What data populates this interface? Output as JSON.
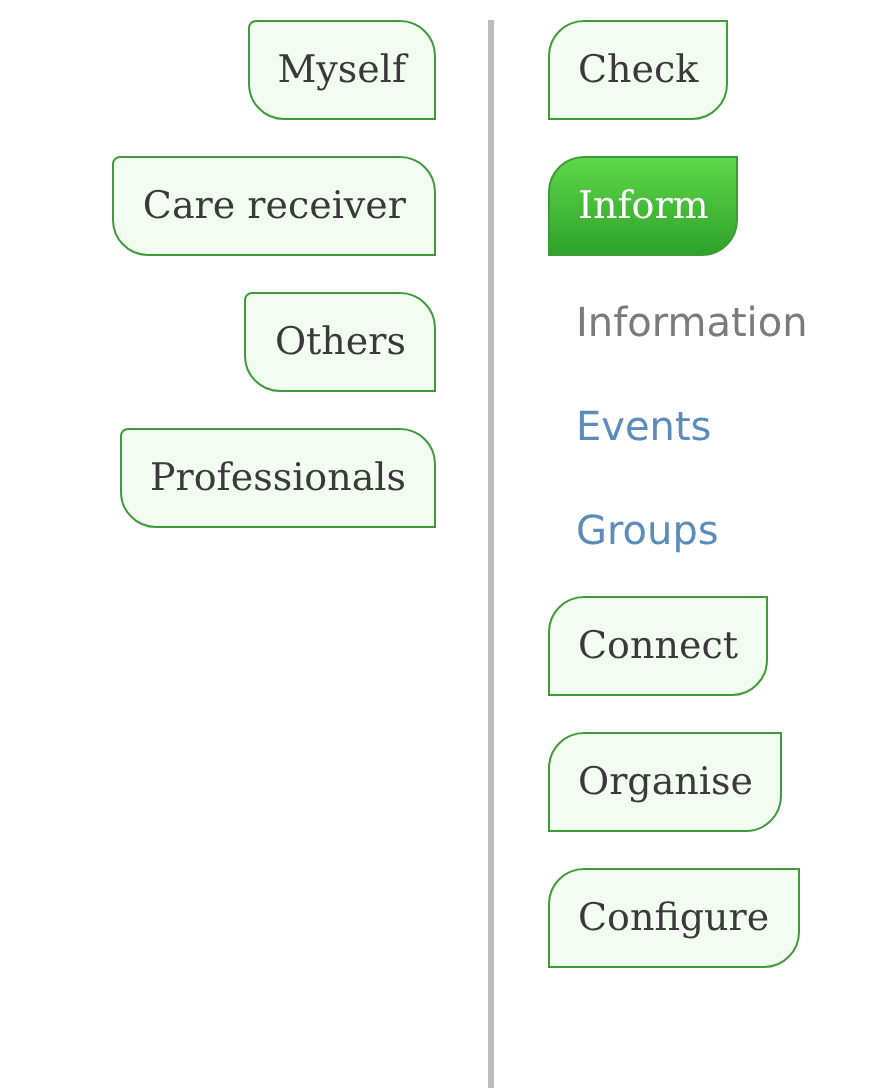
{
  "audiences": [
    {
      "label": "Myself",
      "selected": false
    },
    {
      "label": "Care receiver",
      "selected": false
    },
    {
      "label": "Others",
      "selected": false
    },
    {
      "label": "Professionals",
      "selected": false
    }
  ],
  "sections": [
    {
      "label": "Check",
      "selected": false
    },
    {
      "label": "Inform",
      "selected": true,
      "children": [
        {
          "label": "Information",
          "selected": true
        },
        {
          "label": "Events",
          "selected": false
        },
        {
          "label": "Groups",
          "selected": false
        }
      ]
    },
    {
      "label": "Connect",
      "selected": false
    },
    {
      "label": "Organise",
      "selected": false
    },
    {
      "label": "Configure",
      "selected": false
    }
  ]
}
